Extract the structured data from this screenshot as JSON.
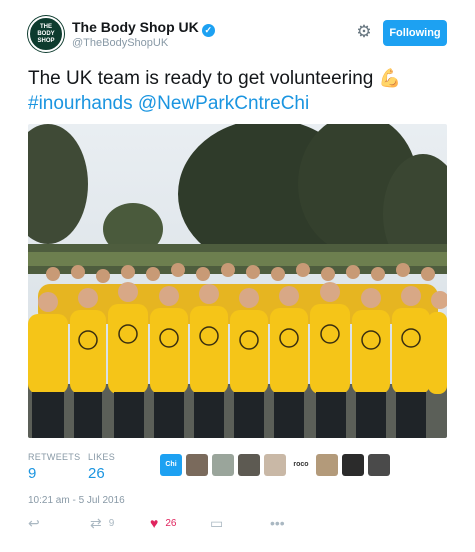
{
  "account": {
    "name": "The Body Shop UK",
    "handle": "@TheBodyShopUK",
    "avatar_text": [
      "THE",
      "BODY",
      "SHOP"
    ]
  },
  "follow_label": "Following",
  "tweet": {
    "line1": "The UK team is ready to get volunteering",
    "hashtag": "#inourhands",
    "mention": "@NewParkCntreChi"
  },
  "stats": {
    "retweets_label": "RETWEETS",
    "retweets": "9",
    "likes_label": "LIKES",
    "likes": "26"
  },
  "likers": [
    {
      "label": "Chi BID",
      "color": "#1da1f2"
    },
    {
      "label": "",
      "color": "#7a6a5c"
    },
    {
      "label": "",
      "color": "#9aa59b"
    },
    {
      "label": "",
      "color": "#5d5a52"
    },
    {
      "label": "",
      "color": "#c9b8a6"
    },
    {
      "label": "roco",
      "color": "#ffffff"
    },
    {
      "label": "",
      "color": "#b39a7a"
    },
    {
      "label": "",
      "color": "#2b2b2b"
    },
    {
      "label": "",
      "color": "#4a4a4a"
    }
  ],
  "timestamp": "10:21 am - 5 Jul 2016",
  "actions": {
    "retweet_count": "9",
    "like_count": "26"
  },
  "colors": {
    "accent": "#1da1f2",
    "link": "#1b95e0",
    "like": "#e0245e",
    "shirt": "#f5c518"
  }
}
